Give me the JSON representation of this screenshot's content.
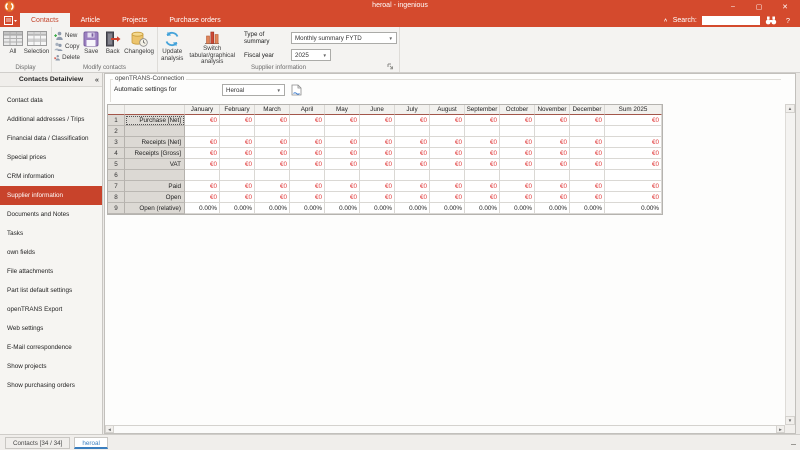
{
  "titlebar": {
    "title": "heroal - ingenious"
  },
  "icons": {
    "minimize": "–",
    "maximize": "▢",
    "close": "✕",
    "dropdown": "▼",
    "collapse_ribbon": "∧",
    "help": "?",
    "sidebar_collapse": "«",
    "up": "▲",
    "down": "▼",
    "left": "◄",
    "right": "►"
  },
  "menu": {
    "tabs": [
      "Contacts",
      "Article",
      "Projects",
      "Purchase orders"
    ],
    "active_tab": "Contacts",
    "search_label": "Search:",
    "search_value": "",
    "help": "?"
  },
  "ribbon": {
    "display_group": {
      "label": "Display",
      "buttons": [
        "All",
        "Selection"
      ]
    },
    "modify_group": {
      "label": "Modify contacts",
      "small_buttons": [
        "New",
        "Copy",
        "Delete"
      ],
      "large_buttons": [
        "Save",
        "Back",
        "Changelog"
      ]
    },
    "supplier_group": {
      "label": "Supplier information",
      "update_button": "Update analysis",
      "switch_button": "Switch tabular/graphical analysis",
      "type_of_summary_label": "Type of summary",
      "type_of_summary_value": "Monthly summary FYTD",
      "fiscal_year_label": "Fiscal year",
      "fiscal_year_value": "2025"
    }
  },
  "sidebar": {
    "header": "Contacts Detailview",
    "selected": "Supplier information",
    "items": [
      "Contact data",
      "Additional addresses / Trips",
      "Financial data / Classification",
      "Special prices",
      "CRM information",
      "Supplier information",
      "Documents and Notes",
      "Tasks",
      "own fields",
      "File attachments",
      "Part list default settings",
      "openTRANS Export",
      "Web settings",
      "E-Mail correspondence",
      "Show projects",
      "Show purchasing orders"
    ]
  },
  "content": {
    "fieldset_label": "openTRANS-Connection",
    "settings_label": "Automatic settings for",
    "settings_value": "Heroal"
  },
  "table": {
    "months": [
      "January",
      "February",
      "March",
      "April",
      "May",
      "June",
      "July",
      "August",
      "September",
      "October",
      "November",
      "December"
    ],
    "sum_header": "Sum 2025",
    "rows": [
      {
        "num": "1",
        "label": "Purchase [Net]",
        "value": "€0",
        "type": "currency",
        "selected": true
      },
      {
        "num": "2",
        "label": "",
        "value": "",
        "type": "empty"
      },
      {
        "num": "3",
        "label": "Receipts [Net]",
        "value": "€0",
        "type": "currency"
      },
      {
        "num": "4",
        "label": "Receipts [Gross]",
        "value": "€0",
        "type": "currency"
      },
      {
        "num": "5",
        "label": "VAT",
        "value": "€0",
        "type": "currency"
      },
      {
        "num": "6",
        "label": "",
        "value": "",
        "type": "empty"
      },
      {
        "num": "7",
        "label": "Paid",
        "value": "€0",
        "type": "currency"
      },
      {
        "num": "8",
        "label": "Open",
        "value": "€0",
        "type": "currency"
      },
      {
        "num": "9",
        "label": "Open (relative)",
        "value": "0.00%",
        "type": "percent"
      }
    ]
  },
  "statusbar": {
    "tabs": [
      "Contacts [34 / 34]",
      "heroal"
    ],
    "active_tab": "heroal"
  },
  "colors": {
    "accent": "#d44a2d",
    "selection": "#c8432b",
    "value_red": "#e03636",
    "tab_blue": "#3a7ebf",
    "header_underline": "#a3564a"
  }
}
